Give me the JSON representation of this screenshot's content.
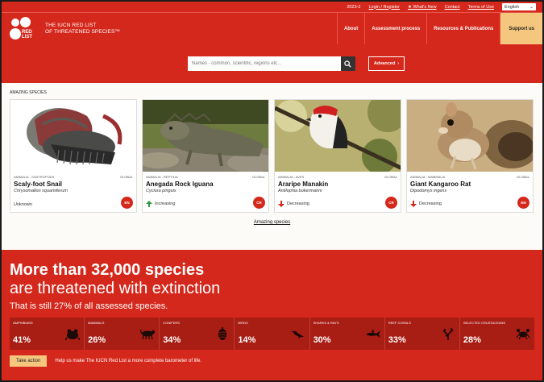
{
  "utility": {
    "version": "2023-2",
    "login": "Login / Register",
    "whats_new": "★ What's New",
    "contact": "Contact",
    "terms": "Terms of Use",
    "language": "English"
  },
  "brand": {
    "logo_text": "RED LIST",
    "title_line1": "THE IUCN RED LIST",
    "title_line2": "OF THREATENED SPECIES™"
  },
  "nav": {
    "about": "About",
    "assessment": "Assessment process",
    "resources": "Resources & Publications",
    "support": "Support us"
  },
  "search": {
    "placeholder": "Names - common, scientific, regions etc...",
    "advanced_label": "Advanced"
  },
  "amazing": {
    "heading": "AMAZING SPECIES",
    "link": "Amazing species",
    "cards": [
      {
        "taxon": "ANIMALIA - GASTROPODA",
        "scope": "GLOBAL",
        "name": "Scaly-foot Snail",
        "scientific": "Chrysomallon squamiferum",
        "trend": "Unknown",
        "trend_icon": "none",
        "category": "EN"
      },
      {
        "taxon": "ANIMALIA - REPTILIA",
        "scope": "GLOBAL",
        "name": "Anegada Rock Iguana",
        "scientific": "Cyclura pinguis",
        "trend": "Increasing",
        "trend_icon": "arrow-up",
        "category": "CR"
      },
      {
        "taxon": "ANIMALIA - AVES",
        "scope": "GLOBAL",
        "name": "Araripe Manakin",
        "scientific": "Antilophia bokermanni",
        "trend": "Decreasing",
        "trend_icon": "arrow-down",
        "category": "CR"
      },
      {
        "taxon": "ANIMALIA - MAMMALIA",
        "scope": "GLOBAL",
        "name": "Giant Kangaroo Rat",
        "scientific": "Dipodomys ingens",
        "trend": "Decreasing",
        "trend_icon": "arrow-down",
        "category": "EN"
      }
    ]
  },
  "threat": {
    "headline_bold": "More than 32,000 species",
    "headline_rest": "are threatened with extinction",
    "subline": "That is still 27% of all assessed species.",
    "stats": [
      {
        "label": "AMPHIBIANS",
        "value": "41%",
        "icon": "frog-icon"
      },
      {
        "label": "MAMMALS",
        "value": "26%",
        "icon": "leopard-icon"
      },
      {
        "label": "CONIFERS",
        "value": "34%",
        "icon": "pinecone-icon"
      },
      {
        "label": "BIRDS",
        "value": "14%",
        "icon": "bird-icon"
      },
      {
        "label": "SHARKS & RAYS",
        "value": "30%",
        "icon": "shark-icon"
      },
      {
        "label": "REEF CORALS",
        "value": "33%",
        "icon": "coral-icon"
      },
      {
        "label": "SELECTED CRUSTACEANS",
        "value": "28%",
        "icon": "crab-icon"
      }
    ],
    "cta_button": "Take action",
    "cta_text": "Help us make The IUCN Red List a more complete barometer of life."
  },
  "colors": {
    "brand_red": "#d5281c",
    "support_yellow": "#f5c77e"
  }
}
